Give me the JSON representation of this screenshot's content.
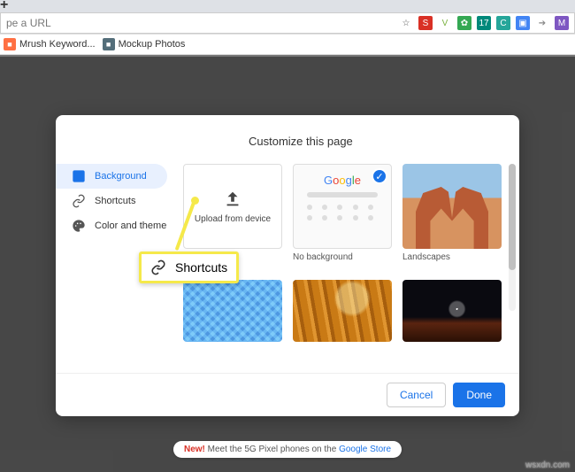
{
  "tabstrip": {
    "plus": "+"
  },
  "omnibox": {
    "placeholder": "pe a URL"
  },
  "extensions": [
    {
      "name": "star-icon",
      "bg": "transparent",
      "glyph": "☆",
      "color": "#555"
    },
    {
      "name": "ext-red",
      "bg": "#d93025",
      "glyph": "S"
    },
    {
      "name": "ext-check",
      "bg": "transparent",
      "glyph": "V",
      "color": "#7cb342"
    },
    {
      "name": "ext-green1",
      "bg": "#34a853",
      "glyph": "✿"
    },
    {
      "name": "ext-green2",
      "bg": "#00897b",
      "glyph": "17"
    },
    {
      "name": "ext-teal",
      "bg": "#26a69a",
      "glyph": "C"
    },
    {
      "name": "ext-blue",
      "bg": "#4285f4",
      "glyph": "▣"
    },
    {
      "name": "ext-arrow",
      "bg": "transparent",
      "glyph": "➔",
      "color": "#888"
    },
    {
      "name": "ext-purple",
      "bg": "#7e57c2",
      "glyph": "M"
    }
  ],
  "bookmarks": [
    {
      "label": "Mrush Keyword...",
      "icon_bg": "#ff7043"
    },
    {
      "label": "Mockup Photos",
      "icon_bg": "#546e7a"
    }
  ],
  "dialog": {
    "title": "Customize this page",
    "sidebar": {
      "items": [
        {
          "label": "Background",
          "icon": "image-icon"
        },
        {
          "label": "Shortcuts",
          "icon": "link-icon"
        },
        {
          "label": "Color and theme",
          "icon": "palette-icon"
        }
      ]
    },
    "tiles": {
      "upload_label": "Upload from device",
      "no_bg_label": "No background",
      "landscapes_label": "Landscapes",
      "google_text": "Google"
    },
    "footer": {
      "cancel": "Cancel",
      "done": "Done"
    }
  },
  "callout": {
    "label": "Shortcuts"
  },
  "promo": {
    "prefix": "New!",
    "text": " Meet the 5G Pixel phones on the ",
    "link": "Google Store"
  },
  "watermark": "wsxdn.com"
}
